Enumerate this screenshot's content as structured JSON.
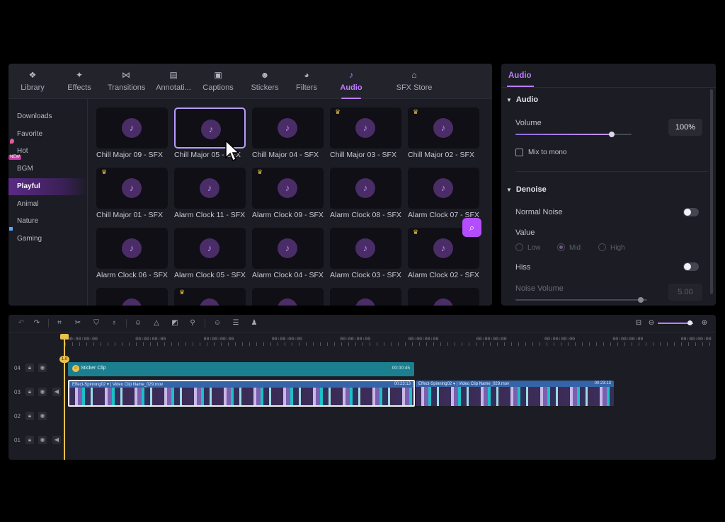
{
  "media_panel": {
    "tabs": [
      {
        "label": "Library",
        "icon": "library-icon",
        "glyph": "❖"
      },
      {
        "label": "Effects",
        "icon": "effects-sparkle-icon",
        "glyph": "✦"
      },
      {
        "label": "Transitions",
        "icon": "transitions-icon",
        "glyph": "⋈"
      },
      {
        "label": "Annotati...",
        "icon": "annotation-icon",
        "glyph": "▤"
      },
      {
        "label": "Captions",
        "icon": "captions-icon",
        "glyph": "▣"
      },
      {
        "label": "Stickers",
        "icon": "stickers-icon",
        "glyph": "☻"
      },
      {
        "label": "Filters",
        "icon": "filters-icon",
        "glyph": "◕"
      },
      {
        "label": "Audio",
        "icon": "music-note-icon",
        "glyph": "♪"
      },
      {
        "label": "SFX Store",
        "icon": "store-icon",
        "glyph": "⌂"
      }
    ],
    "active_tab": "Audio",
    "categories": [
      {
        "label": "Downloads"
      },
      {
        "label": "Favorite"
      },
      {
        "label": "Hot",
        "badge": "dot"
      },
      {
        "label": "BGM",
        "badge": "NEW"
      },
      {
        "label": "Playful"
      },
      {
        "label": "Animal"
      },
      {
        "label": "Nature"
      },
      {
        "label": "Gaming",
        "badge": "square"
      }
    ],
    "active_category": "Playful",
    "audio_items": [
      {
        "label": "Chill Major 09 - SFX",
        "premium": false
      },
      {
        "label": "Chill Major 05 - SFX",
        "premium": false,
        "selected": true
      },
      {
        "label": "Chill Major 04 - SFX",
        "premium": false
      },
      {
        "label": "Chill Major 03 - SFX",
        "premium": true
      },
      {
        "label": "Chill Major 02 - SFX",
        "premium": true
      },
      {
        "label": "Chill Major 01 - SFX",
        "premium": true
      },
      {
        "label": "Alarm Clock 11 - SFX",
        "premium": false
      },
      {
        "label": "Alarm Clock 09 - SFX",
        "premium": true
      },
      {
        "label": "Alarm Clock 08 - SFX",
        "premium": false
      },
      {
        "label": "Alarm Clock 07 - SFX",
        "premium": false
      },
      {
        "label": "Alarm Clock 06 - SFX",
        "premium": false
      },
      {
        "label": "Alarm Clock 05 - SFX",
        "premium": false
      },
      {
        "label": "Alarm Clock 04 - SFX",
        "premium": false
      },
      {
        "label": "Alarm Clock 03 - SFX",
        "premium": false
      },
      {
        "label": "Alarm Clock 02 - SFX",
        "premium": true
      },
      {
        "label": "",
        "premium": false
      },
      {
        "label": "",
        "premium": true
      },
      {
        "label": "",
        "premium": false
      },
      {
        "label": "",
        "premium": false
      },
      {
        "label": "",
        "premium": false
      }
    ]
  },
  "properties": {
    "tab": "Audio",
    "audio_section": {
      "title": "Audio",
      "volume_label": "Volume",
      "volume_value": "100%",
      "volume_level": 0.83,
      "mix_to_mono": "Mix to mono"
    },
    "denoise_section": {
      "title": "Denoise",
      "normal_noise": "Normal Noise",
      "value_label": "Value",
      "options": [
        "Low",
        "Mid",
        "High"
      ],
      "selected_option": "Mid",
      "hiss": "Hiss",
      "noise_volume": "Noise Volume",
      "noise_volume_value": "5.00",
      "noise_volume_level": 0.95
    }
  },
  "timeline": {
    "ruler_labels": [
      "00:00:00:00",
      "00:00:00:00",
      "00:00:00:00",
      "00:00:00:00",
      "00:00:00:00",
      "00:00:00:00",
      "00:00:00:00",
      "00:00:00:00",
      "00:00:00:00",
      "00:00:00:00"
    ],
    "tracks": [
      "04",
      "03",
      "02",
      "01"
    ],
    "sticker_clip": {
      "name": "Sticker Clip",
      "time": "00:00:45"
    },
    "video_clips": [
      {
        "effect": "Effect-Spinning02",
        "name": "Video Clip Name_029.mov",
        "time": "00:23:13"
      },
      {
        "effect": "Effect-Spinning02",
        "name": "Video Clip Name_029.mov",
        "time": "00:23:13"
      }
    ],
    "marker": "1.0"
  },
  "colors": {
    "accent": "#c07cff",
    "sticker_clip": "#1b7f8f",
    "video_clip": "#3564a8",
    "playhead": "#e8c04a"
  }
}
